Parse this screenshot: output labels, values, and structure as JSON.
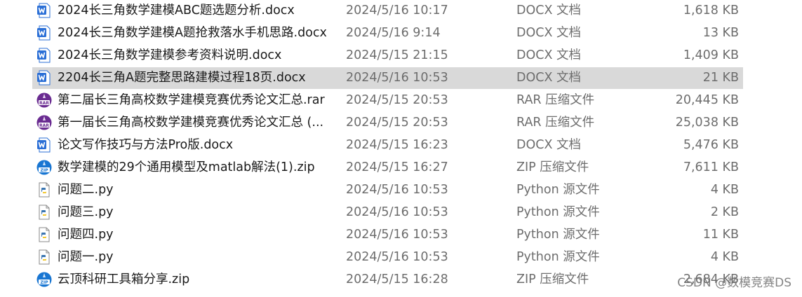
{
  "files": [
    {
      "name": "2024长三角数学建模ABC题选题分析.docx",
      "modified": "2024/5/16 10:17",
      "type": "DOCX 文档",
      "size": "1,618 KB",
      "icon": "docx-icon",
      "selected": false
    },
    {
      "name": "2024长三角数学建模A题抢救落水手机思路.docx",
      "modified": "2024/5/16 9:14",
      "type": "DOCX 文档",
      "size": "13 KB",
      "icon": "docx-icon",
      "selected": false
    },
    {
      "name": "2024长三角数学建模参考资料说明.docx",
      "modified": "2024/5/15 21:15",
      "type": "DOCX 文档",
      "size": "1,409 KB",
      "icon": "docx-icon",
      "selected": false
    },
    {
      "name": "2204长三角A题完整思路建模过程18页.docx",
      "modified": "2024/5/16 10:53",
      "type": "DOCX 文档",
      "size": "21 KB",
      "icon": "docx-icon",
      "selected": true
    },
    {
      "name": "第二届长三角高校数学建模竞赛优秀论文汇总.rar",
      "modified": "2024/5/15 20:53",
      "type": "RAR 压缩文件",
      "size": "20,445 KB",
      "icon": "rar-icon",
      "selected": false
    },
    {
      "name": "第一届长三角高校数学建模竞赛优秀论文汇总 (...",
      "modified": "2024/5/15 20:53",
      "type": "RAR 压缩文件",
      "size": "25,038 KB",
      "icon": "rar-icon",
      "selected": false
    },
    {
      "name": "论文写作技巧与方法Pro版.docx",
      "modified": "2024/5/15 16:23",
      "type": "DOCX 文档",
      "size": "5,476 KB",
      "icon": "docx-icon",
      "selected": false
    },
    {
      "name": "数学建模的29个通用模型及matlab解法(1).zip",
      "modified": "2024/5/15 16:27",
      "type": "ZIP 压缩文件",
      "size": "7,611 KB",
      "icon": "zip-icon",
      "selected": false
    },
    {
      "name": "问题二.py",
      "modified": "2024/5/16 10:53",
      "type": "Python 源文件",
      "size": "4 KB",
      "icon": "python-file-icon",
      "selected": false
    },
    {
      "name": "问题三.py",
      "modified": "2024/5/16 10:53",
      "type": "Python 源文件",
      "size": "2 KB",
      "icon": "python-file-icon",
      "selected": false
    },
    {
      "name": "问题四.py",
      "modified": "2024/5/16 10:53",
      "type": "Python 源文件",
      "size": "11 KB",
      "icon": "python-file-icon",
      "selected": false
    },
    {
      "name": "问题一.py",
      "modified": "2024/5/16 10:53",
      "type": "Python 源文件",
      "size": "4 KB",
      "icon": "python-file-icon",
      "selected": false
    },
    {
      "name": "云顶科研工具箱分享.zip",
      "modified": "2024/5/15 16:28",
      "type": "ZIP 压缩文件",
      "size": "2,684 KB",
      "icon": "zip-icon",
      "selected": false
    }
  ],
  "watermark": "CSDN @数模竞赛DS",
  "colors": {
    "docx": "#2b6fd6",
    "rar": "#6a2c91",
    "zip": "#1976d2",
    "python": "#3a75b0",
    "selected_row": "#d9d9d9"
  }
}
